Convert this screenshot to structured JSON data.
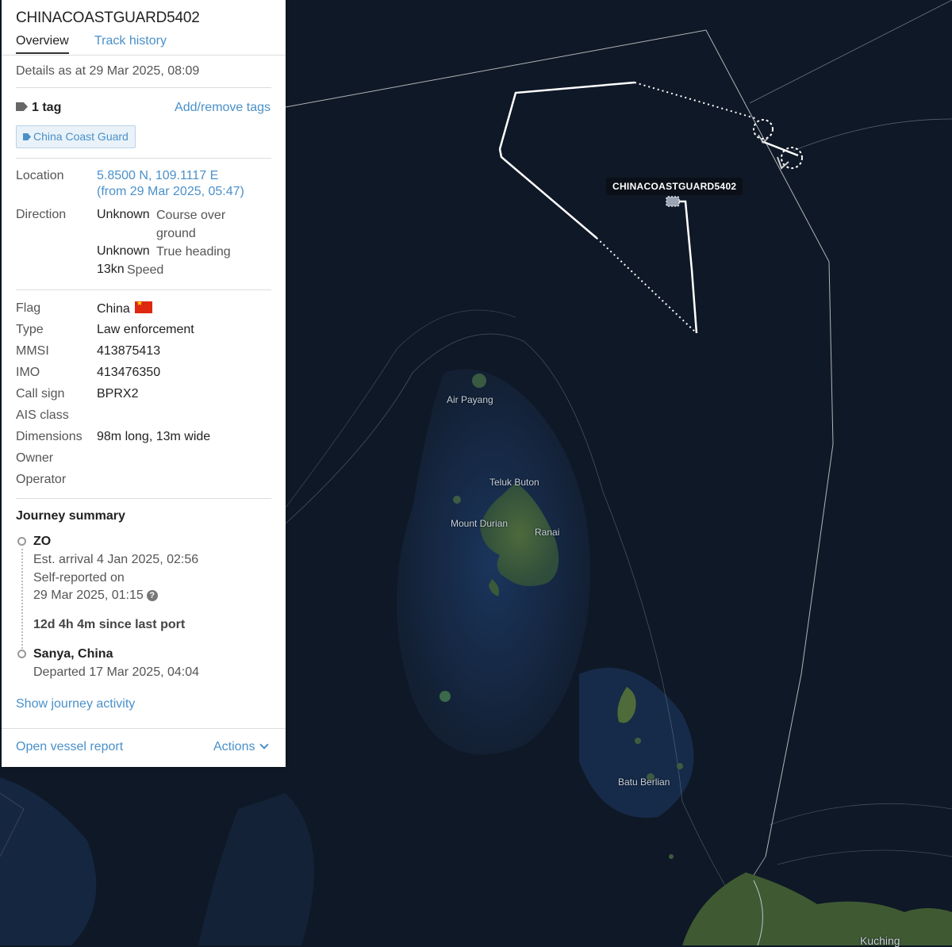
{
  "vessel": {
    "name": "CHINACOASTGUARD5402",
    "tabs": {
      "overview": "Overview",
      "track_history": "Track history"
    },
    "details_as_at": "Details as at 29 Mar 2025, 08:09",
    "tags": {
      "count_label": "1 tag",
      "add_remove": "Add/remove tags",
      "items": [
        "China Coast Guard"
      ]
    },
    "location": {
      "label": "Location",
      "coords": "5.8500 N, 109.1117 E",
      "from": "(from 29 Mar 2025, 05:47)"
    },
    "direction": {
      "label": "Direction",
      "course_value": "Unknown",
      "course_label_1": "Course over",
      "course_label_2": "ground",
      "heading_value": "Unknown",
      "heading_label": "True heading",
      "speed_value": "13kn",
      "speed_label": "Speed"
    },
    "details": [
      {
        "label": "Flag",
        "value": "China"
      },
      {
        "label": "Type",
        "value": "Law enforcement"
      },
      {
        "label": "MMSI",
        "value": "413875413"
      },
      {
        "label": "IMO",
        "value": "413476350"
      },
      {
        "label": "Call sign",
        "value": "BPRX2"
      },
      {
        "label": "AIS class",
        "value": ""
      },
      {
        "label": "Dimensions",
        "value": "98m long, 13m wide"
      },
      {
        "label": "Owner",
        "value": ""
      },
      {
        "label": "Operator",
        "value": ""
      }
    ],
    "journey": {
      "title": "Journey summary",
      "destination": "ZO",
      "est_arrival": "Est. arrival 4 Jan 2025, 02:56",
      "self_reported_1": "Self-reported on",
      "self_reported_2": "29 Mar 2025, 01:15",
      "since_last_port": "12d 4h 4m since last port",
      "origin": "Sanya, China",
      "departed": "Departed 17 Mar 2025, 04:04",
      "show_activity": "Show journey activity"
    },
    "footer": {
      "open_report": "Open vessel report",
      "actions": "Actions"
    }
  },
  "map": {
    "vessel_label": "CHINACOASTGUARD5402",
    "places": [
      "Air Payang",
      "Teluk Buton",
      "Mount Durian",
      "Ranai",
      "Batu Berlian",
      "Kuching"
    ]
  },
  "colors": {
    "link": "#4a90c9",
    "sea": "#0f1826",
    "land": "#3f5a32",
    "track": "#ffffff"
  },
  "icons": [
    "tag-icon",
    "chevron-down-icon",
    "help-icon",
    "flag-cn-icon"
  ]
}
